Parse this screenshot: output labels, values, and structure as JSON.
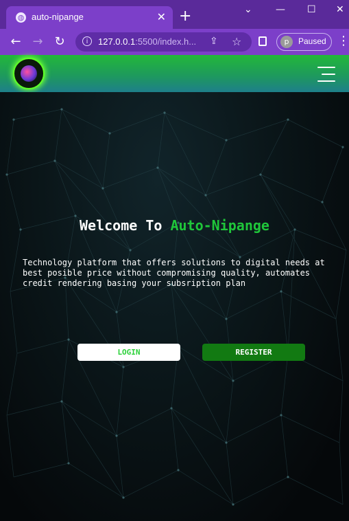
{
  "browser": {
    "tab_title": "auto-nipange",
    "url_host": "127.0.0.1",
    "url_rest": ":5500/index.h...",
    "profile_initial": "p",
    "profile_status": "Paused",
    "new_tab_label": "+",
    "close_tab_label": "✕"
  },
  "header": {
    "logo_icon": "logo-icon",
    "menu_icon": "hamburger-icon"
  },
  "hero": {
    "welcome_prefix": "Welcome To ",
    "brand_name": "Auto-Nipange",
    "description": "Technology platform that offers solutions to digital needs at best posible price without compromising quality, automates credit rendering basing your subsription plan"
  },
  "actions": {
    "login_label": "LOGIN",
    "register_label": "REGISTER"
  },
  "colors": {
    "tab_bar": "#5a2a9a",
    "toolbar": "#7c3fc9",
    "brand_green": "#1fc63a",
    "register_bg": "#127a12",
    "background": "#05080a"
  }
}
